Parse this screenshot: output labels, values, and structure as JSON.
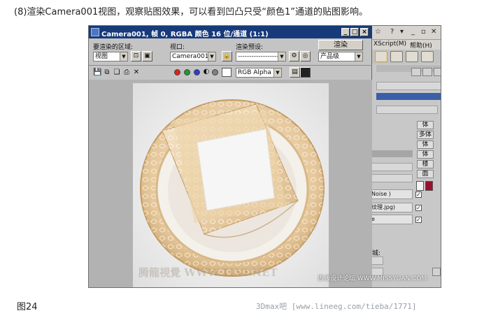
{
  "caption": "(8)渲染Camera001视图，观察贴图效果，可以看到凹凸只受“颜色1”通道的贴图影响。",
  "figure_label": "图24",
  "footer_watermark": "3Dmax吧  [www.lineeg.com/tieba/1771]",
  "render_window": {
    "title": "Camera001, 帧 0, RGBA 颜色 16 位/通道 (1:1)",
    "window_buttons": [
      "_",
      "□",
      "×"
    ],
    "area_label": "要渲染的区域:",
    "area_value": "视图",
    "viewport_label": "视口:",
    "viewport_value": "Camera001",
    "preset_label": "渲染预设:",
    "preset_value": "---------------------",
    "render_button": "渲染",
    "quality_value": "产品级",
    "channel_value": "RGB Alpha",
    "channel_colors": {
      "red": "#e02020",
      "green": "#1e9a2a",
      "blue": "#2a3fcf",
      "mono": "#808080"
    },
    "canvas_watermark": "腾龍視覺 WWW.TLVI.NET"
  },
  "max_ui": {
    "help_menu": "帮助(H)",
    "script_menu": "XScript(M)",
    "side_buttons": [
      "体",
      "多体",
      "体",
      "体",
      "楼",
      "面"
    ],
    "map_slot_1": "Noise )",
    "map_slot_2": "纹理.jpg)",
    "map_slot_3": "e",
    "label_tail": "城:",
    "accent_swatch": "#9a1030"
  },
  "screenshot_watermark": "思缘设计论坛 WWW.MISSYUAN.COM"
}
